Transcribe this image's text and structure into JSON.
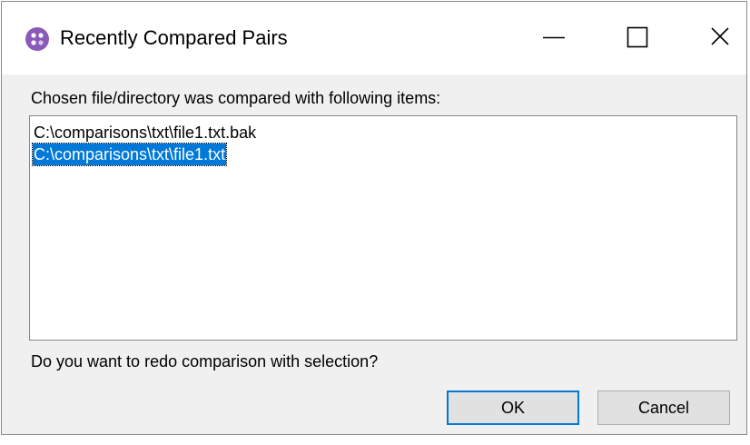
{
  "window": {
    "title": "Recently Compared Pairs",
    "app_icon": "app-logo-icon",
    "controls": {
      "minimize_icon": "minimize-icon",
      "maximize_icon": "maximize-icon",
      "close_icon": "close-icon"
    }
  },
  "dialog": {
    "prompt": "Chosen file/directory was compared with following items:",
    "items": [
      {
        "label": "C:\\comparisons\\txt\\file1.txt.bak",
        "selected": false
      },
      {
        "label": "C:\\comparisons\\txt\\file1.txt",
        "selected": true
      }
    ],
    "question": "Do you want to redo comparison with selection?",
    "buttons": {
      "ok_label": "OK",
      "cancel_label": "Cancel"
    }
  },
  "colors": {
    "selection": "#0078d7",
    "app_icon": "#8a5ab8",
    "default_button_border": "#0078d7"
  }
}
